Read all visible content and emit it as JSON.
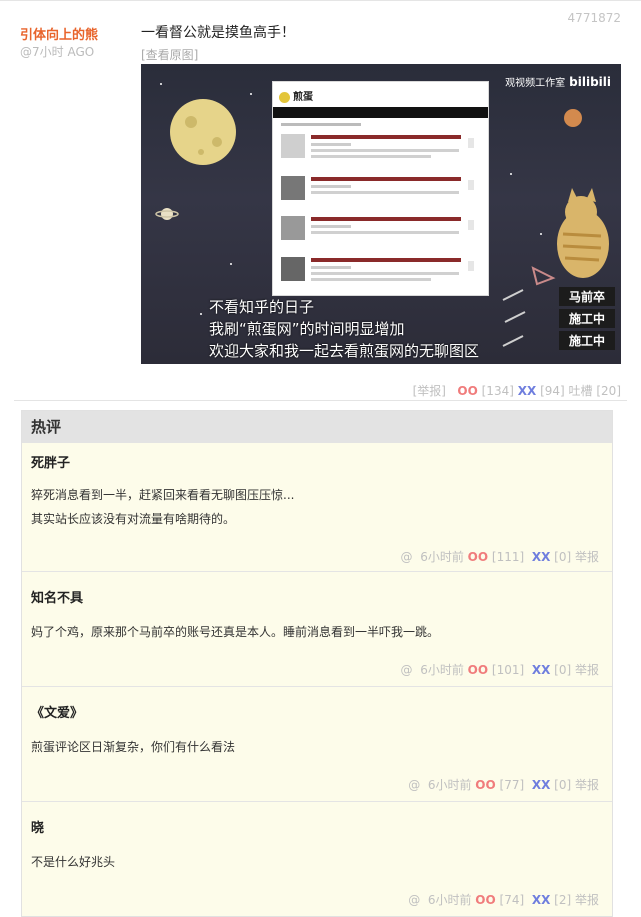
{
  "post": {
    "author": "引体向上的熊",
    "time": "@7小时 AGO",
    "id": "4771872",
    "text": "一看督公就是摸鱼高手！",
    "view_original": "[查看原图]",
    "image": {
      "site_logo": "煎蛋",
      "brand_studio": "观视频工作室",
      "brand_logo": "bilibili",
      "subtitles": [
        "不看知乎的日子",
        "我刷“煎蛋网”的时间明显增加",
        "欢迎大家和我一起去看煎蛋网的无聊图区"
      ],
      "tags": [
        "马前卒",
        "施工中",
        "施工中"
      ]
    },
    "actions": {
      "report": "[举报]",
      "oo_label": "OO",
      "oo_count": "[134]",
      "xx_label": "XX",
      "xx_count": "[94]",
      "tucao": "吐槽 [20]"
    }
  },
  "hot": {
    "title": "热评",
    "comments": [
      {
        "name": "死胖子",
        "lines": [
          "猝死消息看到一半，赶紧回来看看无聊图压压惊...",
          "其实站长应该没有对流量有啥期待的。"
        ],
        "at": "@",
        "time": "6小时前",
        "oo_label": "OO",
        "oo_count": "[111]",
        "xx_label": "XX",
        "xx_count": "[0]",
        "report": "举报"
      },
      {
        "name": "知名不具",
        "lines": [
          "妈了个鸡，原来那个马前卒的账号还真是本人。睡前消息看到一半吓我一跳。"
        ],
        "at": "@",
        "time": "6小时前",
        "oo_label": "OO",
        "oo_count": "[101]",
        "xx_label": "XX",
        "xx_count": "[0]",
        "report": "举报"
      },
      {
        "name": "《文爱》",
        "lines": [
          "煎蛋评论区日渐复杂，你们有什么看法"
        ],
        "at": "@",
        "time": "6小时前",
        "oo_label": "OO",
        "oo_count": "[77]",
        "xx_label": "XX",
        "xx_count": "[0]",
        "report": "举报"
      },
      {
        "name": "晓",
        "lines": [
          "不是什么好兆头"
        ],
        "at": "@",
        "time": "6小时前",
        "oo_label": "OO",
        "oo_count": "[74]",
        "xx_label": "XX",
        "xx_count": "[2]",
        "report": "举报"
      }
    ]
  },
  "colors": {
    "author": "#e8642c",
    "oo": "#f07c7c",
    "xx": "#6f7ede",
    "hot_bg": "#fdfcea",
    "hot_header_bg": "#e3e3e3"
  }
}
